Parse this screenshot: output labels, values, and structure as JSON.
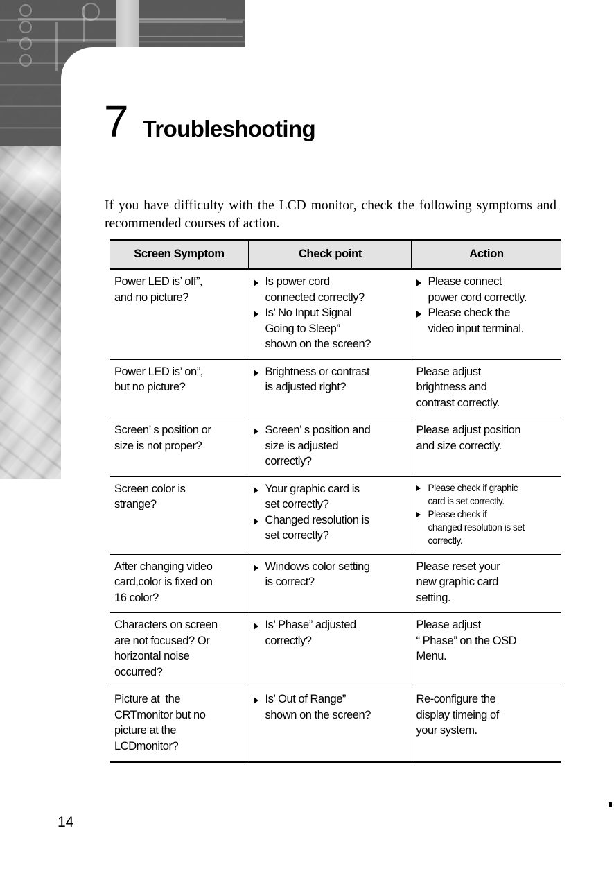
{
  "chapter": {
    "number": "7",
    "title": "Troubleshooting"
  },
  "intro": "If you have difficulty with the LCD monitor, check the following symptoms and recommended courses of action.",
  "table": {
    "headers": [
      "Screen Symptom",
      "Check point",
      "Action"
    ],
    "rows": [
      {
        "symptom": [
          "Power LED is’ off”,",
          "and no picture?"
        ],
        "check": [
          "Is power cord\nconnected correctly?",
          "Is’ No Input Signal\nGoing to Sleep”\nshown on the screen?"
        ],
        "action": [
          "Please connect\npower cord correctly.",
          "Please check the\nvideo input terminal."
        ]
      },
      {
        "symptom": [
          "Power LED is’ on”,",
          "but no picture?"
        ],
        "check": [
          "Brightness or contrast\nis adjusted right?"
        ],
        "action_plain": "Please adjust\nbrightness and\ncontrast correctly."
      },
      {
        "symptom": [
          "Screen’ s position or",
          "size is not proper?"
        ],
        "check": [
          "Screen’ s position and\nsize is adjusted\ncorrectly?"
        ],
        "action_plain": "Please adjust position\nand size correctly."
      },
      {
        "symptom": [
          "Screen color is",
          "strange?"
        ],
        "check": [
          "Your graphic card is\nset correctly?",
          "Changed resolution is\nset correctly?"
        ],
        "action": [
          "Please check if graphic\ncard is set correctly.",
          "Please check if\nchanged resolution is set\ncorrectly."
        ]
      },
      {
        "symptom": [
          "After changing video",
          "card,color is fixed on",
          "16 color?"
        ],
        "check": [
          "Windows color setting\nis correct?"
        ],
        "action_plain": "Please reset your\nnew graphic card\nsetting."
      },
      {
        "symptom": [
          "Characters on screen",
          "are not focused? Or",
          "horizontal noise",
          "occurred?"
        ],
        "check": [
          "Is’ Phase” adjusted\ncorrectly?"
        ],
        "action_plain": "Please adjust\n“ Phase” on the OSD\nMenu."
      },
      {
        "symptom": [
          "Picture at  the",
          "CRTmonitor but no",
          "picture at the",
          "LCDmonitor?"
        ],
        "check": [
          "Is’ Out of Range”\nshown on the screen?"
        ],
        "action_plain": "Re-configure the\ndisplay timeing of\nyour system."
      }
    ]
  },
  "footer": {
    "page_number": "14"
  }
}
